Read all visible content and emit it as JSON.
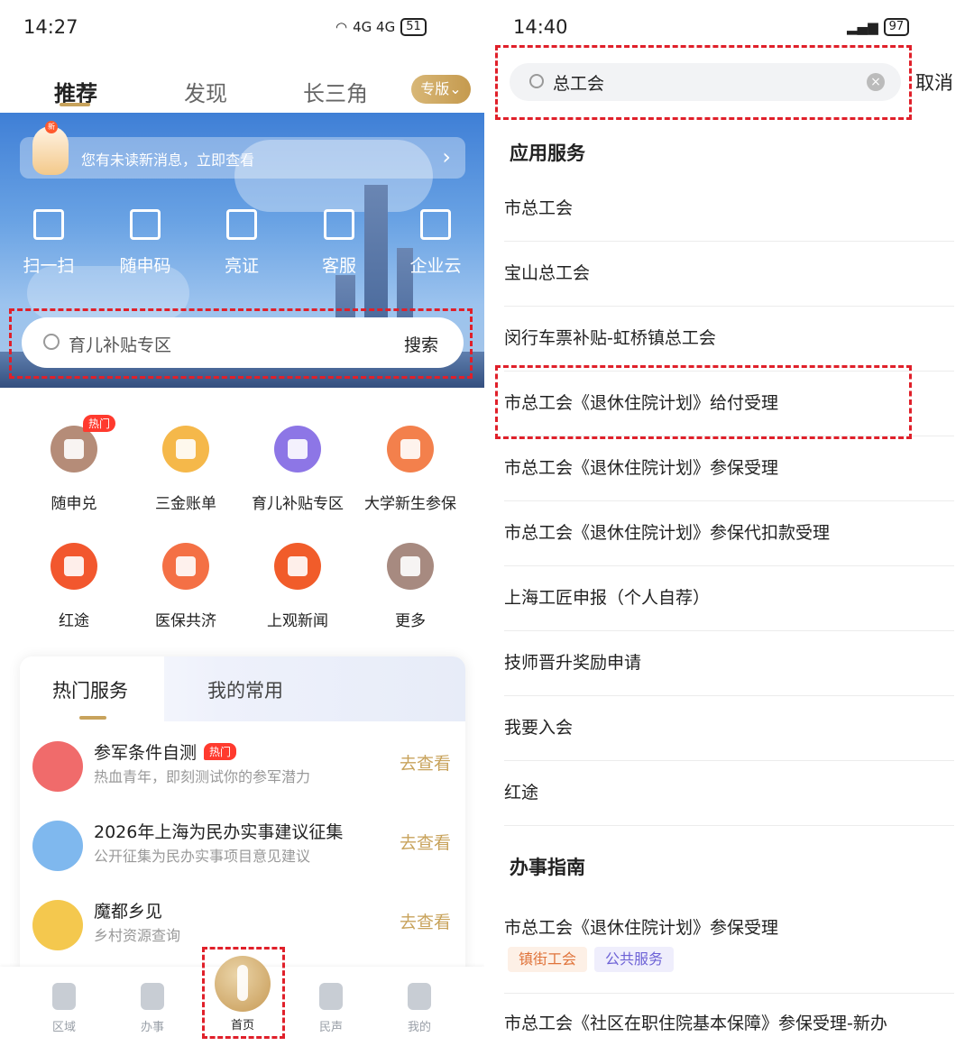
{
  "left": {
    "status": {
      "time": "14:27",
      "signal": "4G 4G",
      "battery": "51"
    },
    "top_tabs": [
      "推荐",
      "发现",
      "长三角"
    ],
    "edition_label": "专版⌄",
    "message_bar": {
      "new_badge": "新",
      "text": "您有未读新消息，立即查看",
      "chevron": "›"
    },
    "quick_actions": [
      {
        "label": "扫一扫",
        "icon": "scan-icon"
      },
      {
        "label": "随申码",
        "icon": "qr-code-icon"
      },
      {
        "label": "亮证",
        "icon": "id-card-icon"
      },
      {
        "label": "客服",
        "icon": "headset-icon"
      },
      {
        "label": "企业云",
        "icon": "building-icon"
      }
    ],
    "search": {
      "placeholder": "育儿补贴专区",
      "button": "搜索"
    },
    "grid": [
      {
        "label": "随申兑",
        "icon": "voucher-icon",
        "color": "#b58c78",
        "badge": "热门"
      },
      {
        "label": "三金账单",
        "icon": "house-coin-icon",
        "color": "#f5b84a"
      },
      {
        "label": "育儿补贴专区",
        "icon": "baby-icon",
        "color": "#8d76e6"
      },
      {
        "label": "大学新生参保",
        "icon": "student-card-icon",
        "color": "#f3804c"
      },
      {
        "label": "红途",
        "icon": "red-star-icon",
        "color": "#f2572e"
      },
      {
        "label": "医保共济",
        "icon": "family-home-icon",
        "color": "#f47045"
      },
      {
        "label": "上观新闻",
        "icon": "camera-aperture-icon",
        "color": "#f15c2a"
      },
      {
        "label": "更多",
        "icon": "more-apps-icon",
        "color": "#a78a80"
      }
    ],
    "hot_services": {
      "tabs": [
        "热门服务",
        "我的常用"
      ],
      "items": [
        {
          "title": "参军条件自测",
          "tag": "热门",
          "subtitle": "热血青年，即刻测试你的参军潜力",
          "action": "去查看",
          "icon": "flag-icon",
          "color": "#f06b6b"
        },
        {
          "title": "2026年上海为民办实事建议征集",
          "tag": "",
          "subtitle": "公开征集为民办实事项目意见建议",
          "action": "去查看",
          "icon": "document-icon",
          "color": "#7fb8ee"
        },
        {
          "title": "魔都乡见",
          "tag": "",
          "subtitle": "乡村资源查询",
          "action": "去查看",
          "icon": "village-house-icon",
          "color": "#f4c84e"
        }
      ]
    },
    "tabbar": [
      {
        "label": "区域",
        "icon": "region-icon"
      },
      {
        "label": "办事",
        "icon": "pen-icon"
      },
      {
        "label": "首页",
        "icon": "pearl-tower-icon"
      },
      {
        "label": "民声",
        "icon": "flower-icon"
      },
      {
        "label": "我的",
        "icon": "person-icon"
      }
    ]
  },
  "right": {
    "status": {
      "time": "14:40",
      "battery": "97"
    },
    "search": {
      "value": "总工会",
      "clear": "×"
    },
    "cancel": "取消",
    "section_apps": "应用服务",
    "apps": [
      "市总工会",
      "宝山总工会",
      "闵行车票补贴-虹桥镇总工会",
      "市总工会《退休住院计划》给付受理",
      "市总工会《退休住院计划》参保受理",
      "市总工会《退休住院计划》参保代扣款受理",
      "上海工匠申报（个人自荐）",
      "技师晋升奖励申请",
      "我要入会",
      "红途"
    ],
    "section_guides": "办事指南",
    "guides": [
      {
        "title": "市总工会《退休住院计划》参保受理",
        "tags": [
          "镇街工会",
          "公共服务"
        ]
      },
      {
        "title": "市总工会《社区在职住院基本保障》参保受理-新办",
        "tags": []
      }
    ],
    "tag_colors": {
      "orange_bg": "#fdf0e6",
      "orange_fg": "#e0733a",
      "purple_bg": "#efeefc",
      "purple_fg": "#6d62d6"
    }
  }
}
